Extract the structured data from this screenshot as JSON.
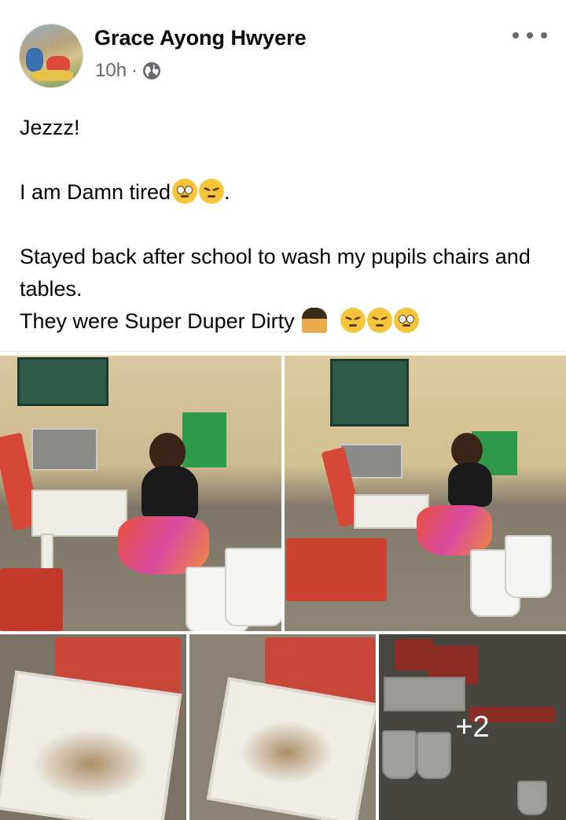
{
  "post": {
    "author": "Grace Ayong Hwyere",
    "time": "10h",
    "separator": "·",
    "privacy_icon": "globe-icon",
    "more_icon": "more-options-icon",
    "text": {
      "line1": "Jezzz!",
      "line2": "I am Damn tired",
      "line2_end": ".",
      "line3": "Stayed back after school to wash my pupils chairs and tables.",
      "line4": "They were Super Duper Dirty"
    },
    "emojis": {
      "line2": [
        "pleading-face-emoji",
        "confounded-face-emoji"
      ],
      "line4": [
        "person-facepalming-emoji",
        "smirking-face-emoji",
        "unamused-face-emoji",
        "face-with-rolling-eyes-emoji"
      ]
    }
  },
  "photos": {
    "more_count": "+2"
  }
}
